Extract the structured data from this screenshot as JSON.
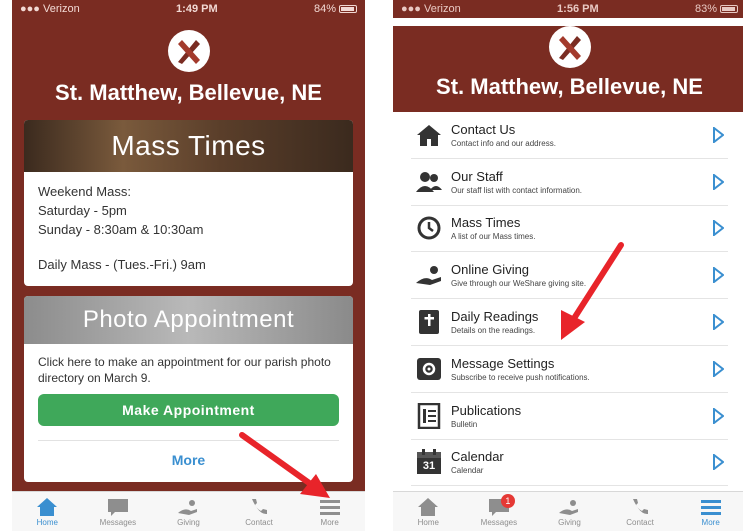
{
  "colors": {
    "brand": "#7a2c22",
    "accent": "#3a8fd0",
    "green": "#3fa85a",
    "arrow": "#e8242a"
  },
  "phone1": {
    "status": {
      "carrier": "Verizon",
      "time": "1:49 PM",
      "battery": "84%"
    },
    "title": "St. Matthew, Bellevue, NE",
    "mass_card": {
      "banner": "Mass Times",
      "lines": [
        "Weekend Mass:",
        "Saturday - 5pm",
        "Sunday - 8:30am & 10:30am"
      ],
      "daily": "Daily Mass - (Tues.-Fri.) 9am"
    },
    "photo_card": {
      "banner": "Photo Appointment",
      "text": "Click here to make an appointment for our parish photo directory on March 9.",
      "button": "Make Appointment",
      "more": "More"
    },
    "tabs": [
      {
        "label": "Home",
        "icon": "home-icon"
      },
      {
        "label": "Messages",
        "icon": "message-icon"
      },
      {
        "label": "Giving",
        "icon": "giving-icon"
      },
      {
        "label": "Contact",
        "icon": "phone-icon"
      },
      {
        "label": "More",
        "icon": "menu-icon"
      }
    ]
  },
  "phone2": {
    "status": {
      "carrier": "Verizon",
      "time": "1:56 PM",
      "battery": "83%"
    },
    "title": "St. Matthew, Bellevue, NE",
    "menu": [
      {
        "title": "Contact Us",
        "subtitle": "Contact info and our address.",
        "icon": "church-icon"
      },
      {
        "title": "Our Staff",
        "subtitle": "Our staff list with contact information.",
        "icon": "people-icon"
      },
      {
        "title": "Mass Times",
        "subtitle": "A list of our Mass times.",
        "icon": "clock-icon"
      },
      {
        "title": "Online Giving",
        "subtitle": "Give through our WeShare giving site.",
        "icon": "giving-icon"
      },
      {
        "title": "Daily Readings",
        "subtitle": "Details on the readings.",
        "icon": "bible-icon"
      },
      {
        "title": "Message Settings",
        "subtitle": "Subscribe to receive push notifications.",
        "icon": "gear-icon"
      },
      {
        "title": "Publications",
        "subtitle": "Bulletin",
        "icon": "publication-icon"
      },
      {
        "title": "Calendar",
        "subtitle": "Calendar",
        "icon": "calendar-icon"
      }
    ],
    "calendar_day": "31",
    "messages_badge": "1",
    "tabs": [
      {
        "label": "Home",
        "icon": "home-icon"
      },
      {
        "label": "Messages",
        "icon": "message-icon"
      },
      {
        "label": "Giving",
        "icon": "giving-icon"
      },
      {
        "label": "Contact",
        "icon": "phone-icon"
      },
      {
        "label": "More",
        "icon": "menu-icon"
      }
    ]
  }
}
